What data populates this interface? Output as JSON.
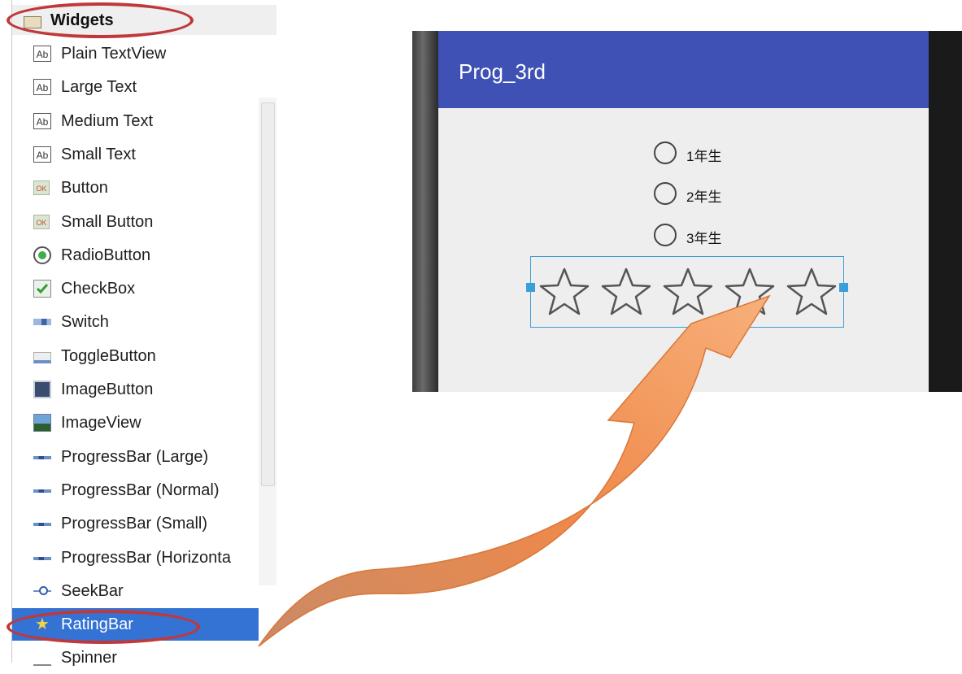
{
  "palette": {
    "header": "Widgets",
    "items": [
      {
        "label": "Plain TextView",
        "icon": "ab-text-icon"
      },
      {
        "label": "Large Text",
        "icon": "ab-text-icon"
      },
      {
        "label": "Medium Text",
        "icon": "ab-text-icon"
      },
      {
        "label": "Small Text",
        "icon": "ab-text-icon"
      },
      {
        "label": "Button",
        "icon": "ok-button-icon"
      },
      {
        "label": "Small Button",
        "icon": "ok-button-icon"
      },
      {
        "label": "RadioButton",
        "icon": "radio-button-icon"
      },
      {
        "label": "CheckBox",
        "icon": "checkbox-icon"
      },
      {
        "label": "Switch",
        "icon": "switch-icon"
      },
      {
        "label": "ToggleButton",
        "icon": "toggle-button-icon"
      },
      {
        "label": "ImageButton",
        "icon": "image-button-icon"
      },
      {
        "label": "ImageView",
        "icon": "image-view-icon"
      },
      {
        "label": "ProgressBar (Large)",
        "icon": "progress-bar-icon"
      },
      {
        "label": "ProgressBar (Normal)",
        "icon": "progress-bar-icon"
      },
      {
        "label": "ProgressBar (Small)",
        "icon": "progress-bar-icon"
      },
      {
        "label": "ProgressBar (Horizonta",
        "icon": "progress-bar-icon"
      },
      {
        "label": "SeekBar",
        "icon": "seekbar-icon"
      },
      {
        "label": "RatingBar",
        "icon": "star-icon",
        "selected": true
      },
      {
        "label": "Spinner",
        "icon": "spinner-icon"
      }
    ],
    "ab_glyph": "Ab",
    "ok_glyph": "OK",
    "star_glyph": "★"
  },
  "preview": {
    "app_title": "Prog_3rd",
    "radio_options": [
      "1年生",
      "2年生",
      "3年生"
    ],
    "rating": {
      "num_stars": 5,
      "rating": 0
    }
  },
  "colors": {
    "selection": "#3472d4",
    "appbar": "#3f51b5",
    "annotation_ellipse": "#c0393a",
    "arrow": "#f0894a",
    "selection_outline": "#3a9ed8"
  }
}
